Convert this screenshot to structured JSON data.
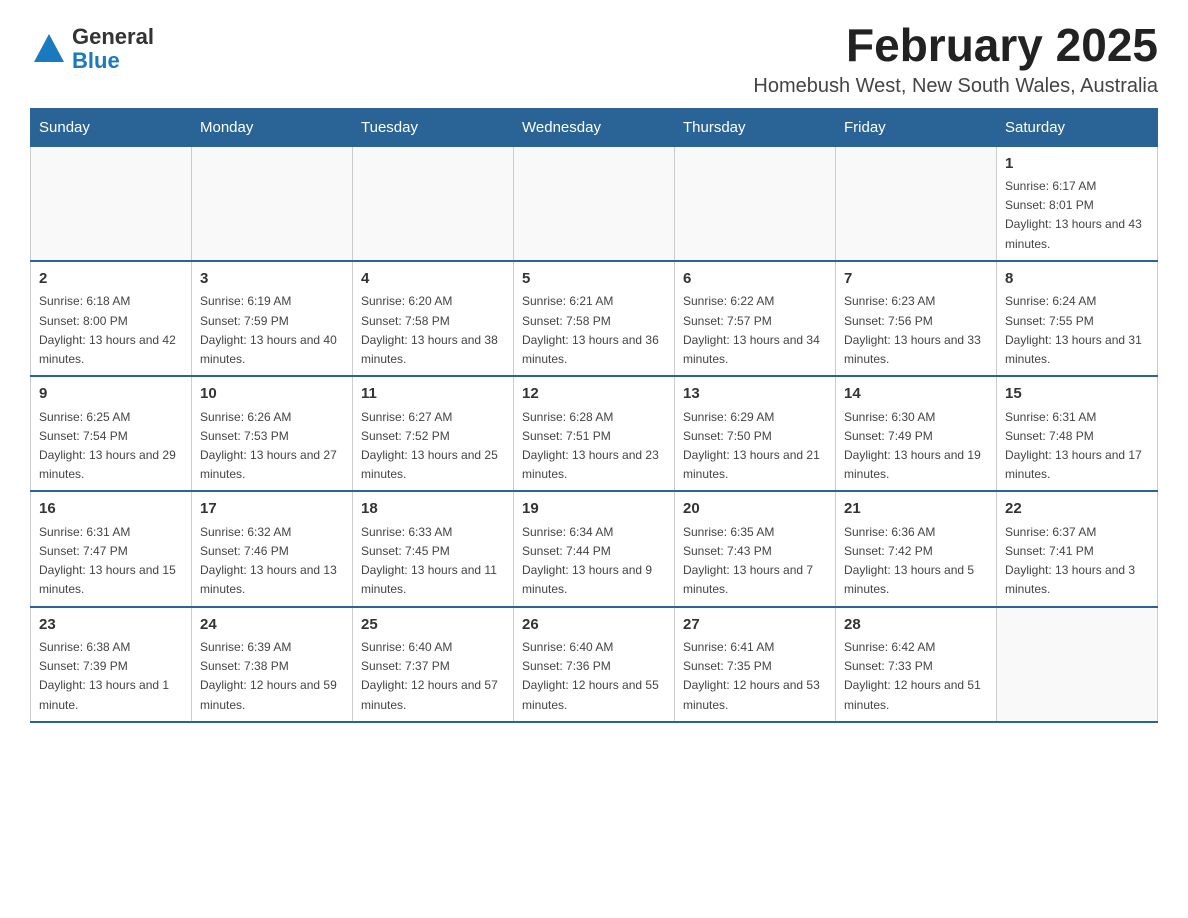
{
  "header": {
    "logo_general": "General",
    "logo_blue": "Blue",
    "month_title": "February 2025",
    "location": "Homebush West, New South Wales, Australia"
  },
  "days_of_week": [
    "Sunday",
    "Monday",
    "Tuesday",
    "Wednesday",
    "Thursday",
    "Friday",
    "Saturday"
  ],
  "weeks": [
    [
      {
        "day": "",
        "info": ""
      },
      {
        "day": "",
        "info": ""
      },
      {
        "day": "",
        "info": ""
      },
      {
        "day": "",
        "info": ""
      },
      {
        "day": "",
        "info": ""
      },
      {
        "day": "",
        "info": ""
      },
      {
        "day": "1",
        "info": "Sunrise: 6:17 AM\nSunset: 8:01 PM\nDaylight: 13 hours and 43 minutes."
      }
    ],
    [
      {
        "day": "2",
        "info": "Sunrise: 6:18 AM\nSunset: 8:00 PM\nDaylight: 13 hours and 42 minutes."
      },
      {
        "day": "3",
        "info": "Sunrise: 6:19 AM\nSunset: 7:59 PM\nDaylight: 13 hours and 40 minutes."
      },
      {
        "day": "4",
        "info": "Sunrise: 6:20 AM\nSunset: 7:58 PM\nDaylight: 13 hours and 38 minutes."
      },
      {
        "day": "5",
        "info": "Sunrise: 6:21 AM\nSunset: 7:58 PM\nDaylight: 13 hours and 36 minutes."
      },
      {
        "day": "6",
        "info": "Sunrise: 6:22 AM\nSunset: 7:57 PM\nDaylight: 13 hours and 34 minutes."
      },
      {
        "day": "7",
        "info": "Sunrise: 6:23 AM\nSunset: 7:56 PM\nDaylight: 13 hours and 33 minutes."
      },
      {
        "day": "8",
        "info": "Sunrise: 6:24 AM\nSunset: 7:55 PM\nDaylight: 13 hours and 31 minutes."
      }
    ],
    [
      {
        "day": "9",
        "info": "Sunrise: 6:25 AM\nSunset: 7:54 PM\nDaylight: 13 hours and 29 minutes."
      },
      {
        "day": "10",
        "info": "Sunrise: 6:26 AM\nSunset: 7:53 PM\nDaylight: 13 hours and 27 minutes."
      },
      {
        "day": "11",
        "info": "Sunrise: 6:27 AM\nSunset: 7:52 PM\nDaylight: 13 hours and 25 minutes."
      },
      {
        "day": "12",
        "info": "Sunrise: 6:28 AM\nSunset: 7:51 PM\nDaylight: 13 hours and 23 minutes."
      },
      {
        "day": "13",
        "info": "Sunrise: 6:29 AM\nSunset: 7:50 PM\nDaylight: 13 hours and 21 minutes."
      },
      {
        "day": "14",
        "info": "Sunrise: 6:30 AM\nSunset: 7:49 PM\nDaylight: 13 hours and 19 minutes."
      },
      {
        "day": "15",
        "info": "Sunrise: 6:31 AM\nSunset: 7:48 PM\nDaylight: 13 hours and 17 minutes."
      }
    ],
    [
      {
        "day": "16",
        "info": "Sunrise: 6:31 AM\nSunset: 7:47 PM\nDaylight: 13 hours and 15 minutes."
      },
      {
        "day": "17",
        "info": "Sunrise: 6:32 AM\nSunset: 7:46 PM\nDaylight: 13 hours and 13 minutes."
      },
      {
        "day": "18",
        "info": "Sunrise: 6:33 AM\nSunset: 7:45 PM\nDaylight: 13 hours and 11 minutes."
      },
      {
        "day": "19",
        "info": "Sunrise: 6:34 AM\nSunset: 7:44 PM\nDaylight: 13 hours and 9 minutes."
      },
      {
        "day": "20",
        "info": "Sunrise: 6:35 AM\nSunset: 7:43 PM\nDaylight: 13 hours and 7 minutes."
      },
      {
        "day": "21",
        "info": "Sunrise: 6:36 AM\nSunset: 7:42 PM\nDaylight: 13 hours and 5 minutes."
      },
      {
        "day": "22",
        "info": "Sunrise: 6:37 AM\nSunset: 7:41 PM\nDaylight: 13 hours and 3 minutes."
      }
    ],
    [
      {
        "day": "23",
        "info": "Sunrise: 6:38 AM\nSunset: 7:39 PM\nDaylight: 13 hours and 1 minute."
      },
      {
        "day": "24",
        "info": "Sunrise: 6:39 AM\nSunset: 7:38 PM\nDaylight: 12 hours and 59 minutes."
      },
      {
        "day": "25",
        "info": "Sunrise: 6:40 AM\nSunset: 7:37 PM\nDaylight: 12 hours and 57 minutes."
      },
      {
        "day": "26",
        "info": "Sunrise: 6:40 AM\nSunset: 7:36 PM\nDaylight: 12 hours and 55 minutes."
      },
      {
        "day": "27",
        "info": "Sunrise: 6:41 AM\nSunset: 7:35 PM\nDaylight: 12 hours and 53 minutes."
      },
      {
        "day": "28",
        "info": "Sunrise: 6:42 AM\nSunset: 7:33 PM\nDaylight: 12 hours and 51 minutes."
      },
      {
        "day": "",
        "info": ""
      }
    ]
  ]
}
